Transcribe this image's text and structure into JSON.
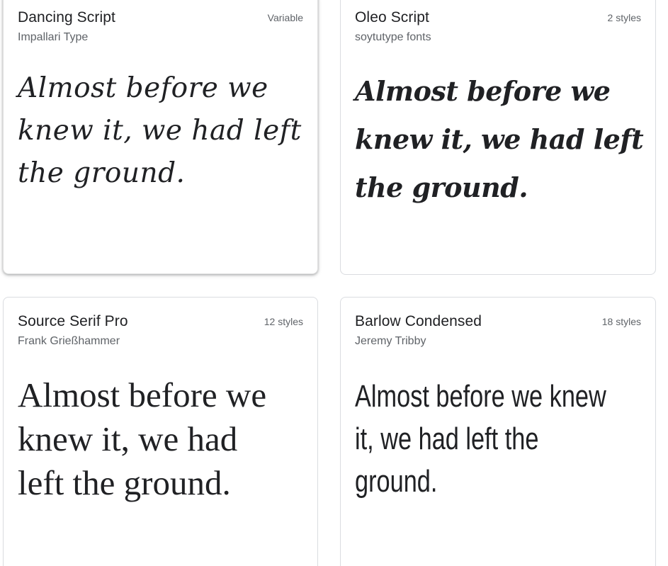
{
  "sample_text": "Almost before we knew it, we had left the ground.",
  "cards": [
    {
      "name": "Dancing Script",
      "author": "Impallari Type",
      "styles": "Variable",
      "sample": [
        "Almost before we",
        "knew it, we had left",
        "the ground."
      ]
    },
    {
      "name": "Oleo Script",
      "author": "soytutype fonts",
      "styles": "2 styles",
      "sample": [
        "Almost before we",
        "knew it, we had left",
        "the ground."
      ]
    },
    {
      "name": "Source Serif Pro",
      "author": "Frank Grießhammer",
      "styles": "12 styles",
      "sample": [
        "Almost before we",
        "knew it, we had",
        "left the ground."
      ]
    },
    {
      "name": "Barlow Condensed",
      "author": "Jeremy Tribby",
      "styles": "18 styles",
      "sample": [
        "Almost before we knew",
        "it, we had left the",
        "ground."
      ]
    }
  ]
}
